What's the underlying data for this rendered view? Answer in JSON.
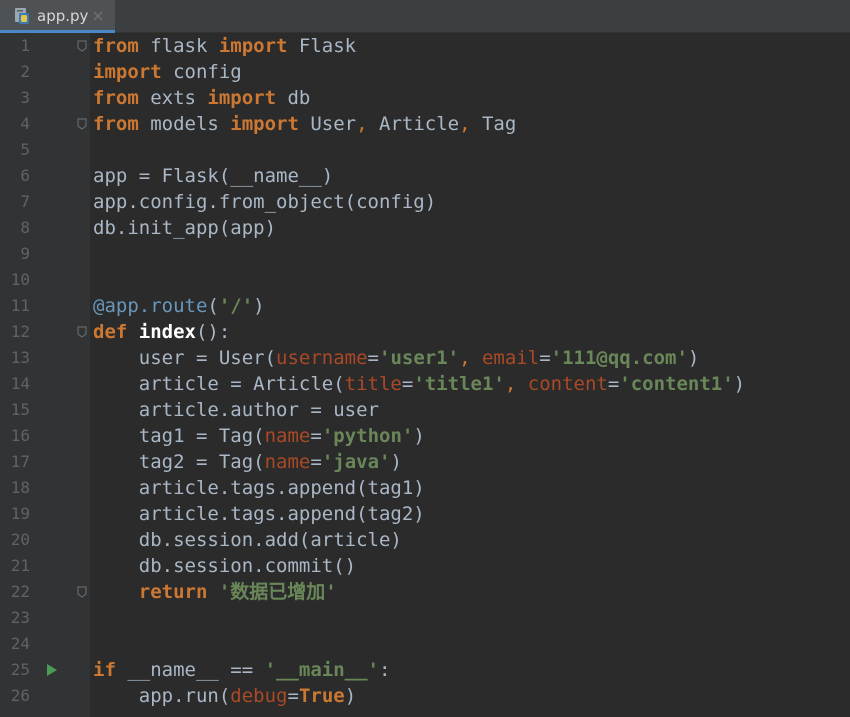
{
  "tab": {
    "label": "app.py"
  },
  "colors": {
    "keyword": "#cc7832",
    "identifier": "#a9b7c6",
    "string": "#6a8759",
    "parameter": "#aa4926",
    "decorator": "#6897bb",
    "line_number": "#606366",
    "run_marker": "#499c54"
  },
  "lines": [
    {
      "n": "1",
      "fold": true,
      "tokens": [
        [
          "keyword",
          "from"
        ],
        [
          "ident",
          " flask "
        ],
        [
          "keyword",
          "import"
        ],
        [
          "ident",
          " Flask"
        ]
      ]
    },
    {
      "n": "2",
      "tokens": [
        [
          "keyword",
          "import"
        ],
        [
          "ident",
          " config"
        ]
      ]
    },
    {
      "n": "3",
      "tokens": [
        [
          "keyword",
          "from"
        ],
        [
          "ident",
          " exts "
        ],
        [
          "keyword",
          "import"
        ],
        [
          "ident",
          " db"
        ]
      ]
    },
    {
      "n": "4",
      "fold": true,
      "tokens": [
        [
          "keyword",
          "from"
        ],
        [
          "ident",
          " models "
        ],
        [
          "keyword",
          "import"
        ],
        [
          "ident",
          " User"
        ],
        [
          "punct",
          ","
        ],
        [
          "ident",
          " Article"
        ],
        [
          "punct",
          ","
        ],
        [
          "ident",
          " Tag"
        ]
      ]
    },
    {
      "n": "5",
      "tokens": []
    },
    {
      "n": "6",
      "tokens": [
        [
          "ident",
          "app = Flask("
        ],
        [
          "dunder",
          "__name__"
        ],
        [
          "ident",
          ")"
        ]
      ]
    },
    {
      "n": "7",
      "tokens": [
        [
          "ident",
          "app.config.from_object(config)"
        ]
      ]
    },
    {
      "n": "8",
      "tokens": [
        [
          "ident",
          "db.init_app(app)"
        ]
      ]
    },
    {
      "n": "9",
      "tokens": []
    },
    {
      "n": "10",
      "tokens": []
    },
    {
      "n": "11",
      "tokens": [
        [
          "decor",
          "@app.route"
        ],
        [
          "ident",
          "("
        ],
        [
          "string",
          "'/'"
        ],
        [
          "ident",
          ")"
        ]
      ]
    },
    {
      "n": "12",
      "fold": true,
      "tokens": [
        [
          "keyword",
          "def "
        ],
        [
          "func",
          "index"
        ],
        [
          "ident",
          "():"
        ]
      ]
    },
    {
      "n": "13",
      "tokens": [
        [
          "ident",
          "    user = User("
        ],
        [
          "param",
          "username"
        ],
        [
          "ident",
          "="
        ],
        [
          "string",
          "'user1'"
        ],
        [
          "punct",
          ","
        ],
        [
          "ident",
          " "
        ],
        [
          "param",
          "email"
        ],
        [
          "ident",
          "="
        ],
        [
          "string",
          "'111@qq.com'"
        ],
        [
          "ident",
          ")"
        ]
      ]
    },
    {
      "n": "14",
      "tokens": [
        [
          "ident",
          "    article = Article("
        ],
        [
          "param",
          "title"
        ],
        [
          "ident",
          "="
        ],
        [
          "string",
          "'title1'"
        ],
        [
          "punct",
          ","
        ],
        [
          "ident",
          " "
        ],
        [
          "param",
          "content"
        ],
        [
          "ident",
          "="
        ],
        [
          "string",
          "'content1'"
        ],
        [
          "ident",
          ")"
        ]
      ]
    },
    {
      "n": "15",
      "tokens": [
        [
          "ident",
          "    article.author = user"
        ]
      ]
    },
    {
      "n": "16",
      "tokens": [
        [
          "ident",
          "    tag1 = Tag("
        ],
        [
          "param",
          "name"
        ],
        [
          "ident",
          "="
        ],
        [
          "string",
          "'python'"
        ],
        [
          "ident",
          ")"
        ]
      ]
    },
    {
      "n": "17",
      "tokens": [
        [
          "ident",
          "    tag2 = Tag("
        ],
        [
          "param",
          "name"
        ],
        [
          "ident",
          "="
        ],
        [
          "string",
          "'java'"
        ],
        [
          "ident",
          ")"
        ]
      ]
    },
    {
      "n": "18",
      "tokens": [
        [
          "ident",
          "    article.tags.append(tag1)"
        ]
      ]
    },
    {
      "n": "19",
      "tokens": [
        [
          "ident",
          "    article.tags.append(tag2)"
        ]
      ]
    },
    {
      "n": "20",
      "tokens": [
        [
          "ident",
          "    db.session.add(article)"
        ]
      ]
    },
    {
      "n": "21",
      "tokens": [
        [
          "ident",
          "    db.session.commit()"
        ]
      ]
    },
    {
      "n": "22",
      "fold": true,
      "tokens": [
        [
          "ident",
          "    "
        ],
        [
          "keyword",
          "return "
        ],
        [
          "string",
          "'数据已增加'"
        ]
      ]
    },
    {
      "n": "23",
      "tokens": []
    },
    {
      "n": "24",
      "tokens": []
    },
    {
      "n": "25",
      "run": true,
      "tokens": [
        [
          "keyword",
          "if "
        ],
        [
          "dunder",
          "__name__"
        ],
        [
          "ident",
          " == "
        ],
        [
          "string",
          "'__main__'"
        ],
        [
          "ident",
          ":"
        ]
      ]
    },
    {
      "n": "26",
      "tokens": [
        [
          "ident",
          "    app.run("
        ],
        [
          "param",
          "debug"
        ],
        [
          "ident",
          "="
        ],
        [
          "keyword",
          "True"
        ],
        [
          "ident",
          ")"
        ]
      ]
    }
  ]
}
